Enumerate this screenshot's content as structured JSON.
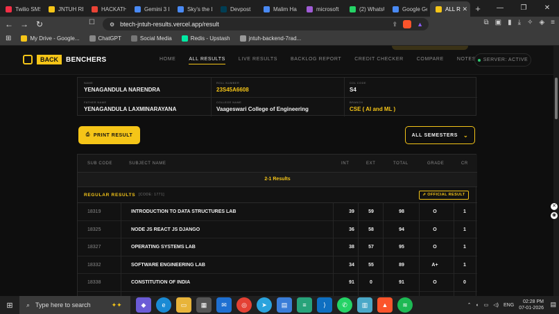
{
  "browser": {
    "tabs": [
      {
        "title": "Twilio SMS",
        "icon_color": "#f22f46"
      },
      {
        "title": "JNTUH RE",
        "icon_color": "#f5c518"
      },
      {
        "title": "HACKATH",
        "icon_color": "#ea4335"
      },
      {
        "title": "Gemini 3 I",
        "icon_color": "#4a8af4"
      },
      {
        "title": "Sky's the L",
        "icon_color": "#4a8af4"
      },
      {
        "title": "Devpost",
        "icon_color": "#003e54"
      },
      {
        "title": "Malim Ha",
        "icon_color": "#4a8af4"
      },
      {
        "title": "microsoft",
        "icon_color": "#a05cd6"
      },
      {
        "title": "(2) WhatsU",
        "icon_color": "#25d366"
      },
      {
        "title": "Google Ge",
        "icon_color": "#4a8af4"
      },
      {
        "title": "ALL R",
        "icon_color": "#f5c518",
        "active": true
      }
    ],
    "url": "btech-jntuh-results.vercel.app/result",
    "bookmarks": [
      {
        "label": "My Drive - Google...",
        "icon_color": "#f5c518"
      },
      {
        "label": "ChatGPT",
        "icon_color": "#888888"
      },
      {
        "label": "Social Media",
        "icon_color": "#777777"
      },
      {
        "label": "Redis - Upstash",
        "icon_color": "#00e9a3"
      },
      {
        "label": "jntuh-backend-7rad...",
        "icon_color": "#999999"
      }
    ]
  },
  "site": {
    "logo_back": "BACK",
    "logo_benchers": "BENCHERS",
    "menu": [
      "HOME",
      "ALL RESULTS",
      "LIVE RESULTS",
      "BACKLOG REPORT",
      "CREDIT CHECKER",
      "COMPARE",
      "NOTES"
    ],
    "active_menu": "ALL RESULTS",
    "server_status": "SERVER: ACTIVE",
    "accent": "#f5c518"
  },
  "student": {
    "name_label": "NAME",
    "name": "YENAGANDULA NARENDRA",
    "roll_label": "ROLL NUMBER",
    "roll": "23S45A6608",
    "col_code_label": "COL CODE",
    "col_code": "S4",
    "father_label": "FATHER NAME",
    "father": "YENAGANDULA LAXMINARAYANA",
    "college_label": "COLLEGE NAME",
    "college": "Vaageswari College of Engineering",
    "branch_label": "BRANCH",
    "branch": "CSE ( AI and ML )"
  },
  "actions": {
    "print": "PRINT RESULT",
    "semester": "ALL SEMESTERS"
  },
  "table": {
    "headers": [
      "SUB CODE",
      "SUBJECT NAME",
      "INT",
      "EXT",
      "TOTAL",
      "GRADE",
      "CR"
    ],
    "semester_title": "2-1 Results",
    "section_title": "REGULAR RESULTS",
    "section_code": "[CODE: 1771]",
    "official": "OFFICIAL RESULT",
    "rows": [
      {
        "code": "18319",
        "name": "INTRODUCTION TO DATA STRUCTURES LAB",
        "int": "39",
        "ext": "59",
        "total": "98",
        "grade": "O",
        "cr": "1"
      },
      {
        "code": "18325",
        "name": "NODE JS REACT JS DJANGO",
        "int": "36",
        "ext": "58",
        "total": "94",
        "grade": "O",
        "cr": "1"
      },
      {
        "code": "18327",
        "name": "OPERATING SYSTEMS LAB",
        "int": "38",
        "ext": "57",
        "total": "95",
        "grade": "O",
        "cr": "1"
      },
      {
        "code": "18332",
        "name": "SOFTWARE ENGINEERING LAB",
        "int": "34",
        "ext": "55",
        "total": "89",
        "grade": "A+",
        "cr": "1"
      },
      {
        "code": "18338",
        "name": "CONSTITUTION OF INDIA",
        "int": "91",
        "ext": "0",
        "total": "91",
        "grade": "O",
        "cr": "0"
      }
    ]
  },
  "taskbar": {
    "search_placeholder": "Type here to search",
    "lang": "ENG",
    "time": "02:28 PM",
    "date": "07-01-2026"
  }
}
